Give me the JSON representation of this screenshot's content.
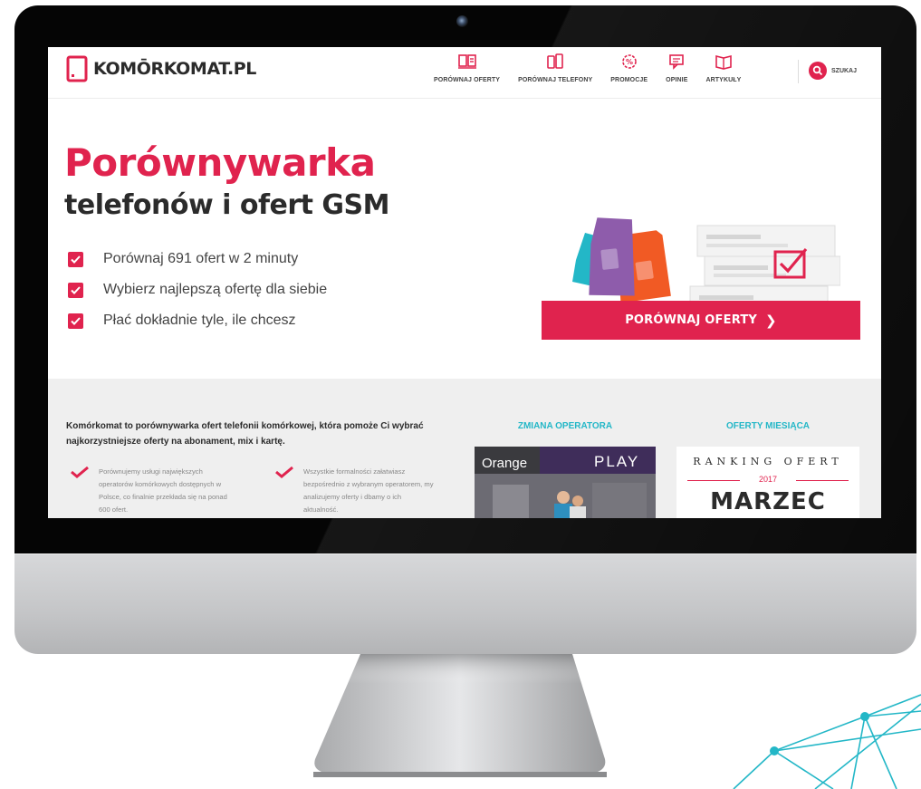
{
  "site": {
    "logo_text": "KOMŌRKOMAT.PL",
    "nav": [
      {
        "label": "PORÓWNAJ OFERTY",
        "icon": "compare-offers-icon"
      },
      {
        "label": "PORÓWNAJ TELEFONY",
        "icon": "compare-phones-icon"
      },
      {
        "label": "PROMOCJE",
        "icon": "promotions-icon"
      },
      {
        "label": "OPINIE",
        "icon": "reviews-icon"
      },
      {
        "label": "ARTYKUŁY",
        "icon": "articles-icon"
      }
    ],
    "search_label": "SZUKAJ"
  },
  "hero": {
    "title_line1": "Porównywarka",
    "title_line2": "telefonów i ofert GSM",
    "benefits": [
      "Porównaj 691 ofert w 2 minuty",
      "Wybierz najlepszą ofertę dla siebie",
      "Płać dokładnie tyle, ile chcesz"
    ],
    "cta_label": "PORÓWNAJ OFERTY",
    "cta_arrow": "❯"
  },
  "about": {
    "intro": "Komórkomat to porównywarka ofert telefonii komórkowej, która pomoże Ci wybrać najkorzystniejsze oferty na abonament, mix i kartę.",
    "col1": "Porównujemy usługi największych operatorów komórkowych dostępnych w Polsce, co finalnie przekłada się na ponad 600 ofert.",
    "col2": "Wszystkie formalności załatwiasz bezpośrednio z wybranym operatorem, my analizujemy oferty i dbamy o ich aktualność."
  },
  "operator_section": {
    "title": "ZMIANA OPERATORA",
    "brand_left": "Orange",
    "brand_right": "PLAY"
  },
  "offers_section": {
    "title": "OFERTY MIESIĄCA",
    "ranking_title": "RANKING OFERT",
    "ranking_year": "2017",
    "ranking_month": "MARZEC"
  },
  "colors": {
    "accent": "#e0234e",
    "teal": "#23b7c7",
    "bezel": "#050505",
    "chin": "#c4c5c7"
  }
}
